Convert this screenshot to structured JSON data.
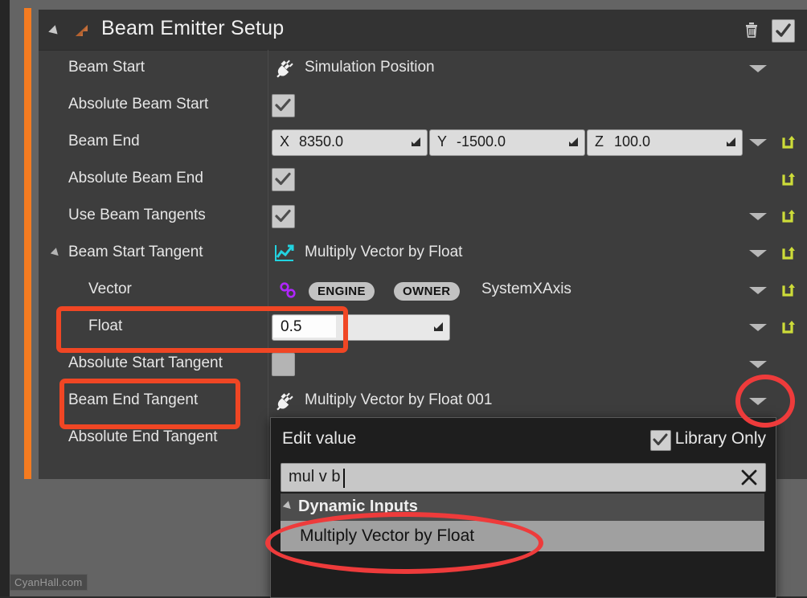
{
  "header": {
    "title": "Beam Emitter Setup",
    "expander_icon": "triangle-down-icon",
    "module_icon": "arrow-module-icon",
    "delete_icon": "trash-icon",
    "enabled_checkbox_label": "enabled",
    "enabled": true
  },
  "colors": {
    "accent_orange": "#f47b20",
    "annotation_red": "#f04624",
    "annotation_ellipse_red": "#ee3b3b",
    "panel_bg": "#3d3d3d",
    "header_bg": "#333333",
    "editor_bg": "#646464",
    "reset_yellow": "#cddc39",
    "icon_cyan": "#22d3e0",
    "icon_purple": "#b026ff"
  },
  "rows": [
    {
      "label": "Beam Start",
      "indent": 1,
      "value_type": "enum",
      "value_icon": "plug-icon",
      "value_text": "Simulation Position",
      "has_dropdown": true,
      "has_reset": false,
      "expander": false
    },
    {
      "label": "Absolute Beam Start",
      "indent": 1,
      "value_type": "checkbox",
      "checked": true,
      "has_dropdown": false,
      "has_reset": false,
      "expander": false
    },
    {
      "label": "Beam End",
      "indent": 1,
      "value_type": "vector",
      "vector": [
        {
          "axis": "X",
          "value": "8350.0"
        },
        {
          "axis": "Y",
          "value": "-1500.0"
        },
        {
          "axis": "Z",
          "value": "100.0"
        }
      ],
      "has_dropdown": true,
      "has_reset": true,
      "expander": false
    },
    {
      "label": "Absolute Beam End",
      "indent": 1,
      "value_type": "checkbox",
      "checked": true,
      "has_dropdown": false,
      "has_reset": true,
      "expander": false
    },
    {
      "label": "Use Beam Tangents",
      "indent": 1,
      "value_type": "checkbox",
      "checked": true,
      "has_dropdown": true,
      "has_reset": true,
      "expander": false
    },
    {
      "label": "Beam Start Tangent",
      "indent": 1,
      "value_type": "enum",
      "value_icon": "dynamic-input-chart-icon",
      "value_text": "Multiply Vector by Float",
      "has_dropdown": true,
      "has_reset": true,
      "expander": true
    },
    {
      "label": "Vector",
      "indent": 2,
      "value_type": "linked",
      "value_icon": "link-chain-icon",
      "pills": [
        "ENGINE",
        "OWNER"
      ],
      "value_text": "SystemXAxis",
      "has_dropdown": true,
      "has_reset": true,
      "expander": false
    },
    {
      "label": "Float",
      "indent": 2,
      "value_type": "float",
      "value_text": "0.5",
      "has_dropdown": true,
      "has_reset": true,
      "expander": false
    },
    {
      "label": "Absolute Start Tangent",
      "indent": 1,
      "value_type": "checkbox",
      "checked": false,
      "has_dropdown": true,
      "has_reset": false,
      "expander": false
    },
    {
      "label": "Beam End Tangent",
      "indent": 1,
      "value_type": "enum",
      "value_icon": "plug-icon",
      "value_text": "Multiply Vector by Float 001",
      "has_dropdown": true,
      "has_reset": false,
      "expander": false
    },
    {
      "label": "Absolute End Tangent",
      "indent": 1,
      "value_type": "none",
      "has_dropdown": false,
      "has_reset": false,
      "expander": false
    }
  ],
  "popup": {
    "title": "Edit value",
    "library_only_label": "Library Only",
    "library_only_checked": true,
    "search_value": "mul v b",
    "clear_icon": "close-x-icon",
    "section_header": "Dynamic Inputs",
    "selected_item": "Multiply Vector by Float"
  },
  "watermark": "CyanHall.com"
}
